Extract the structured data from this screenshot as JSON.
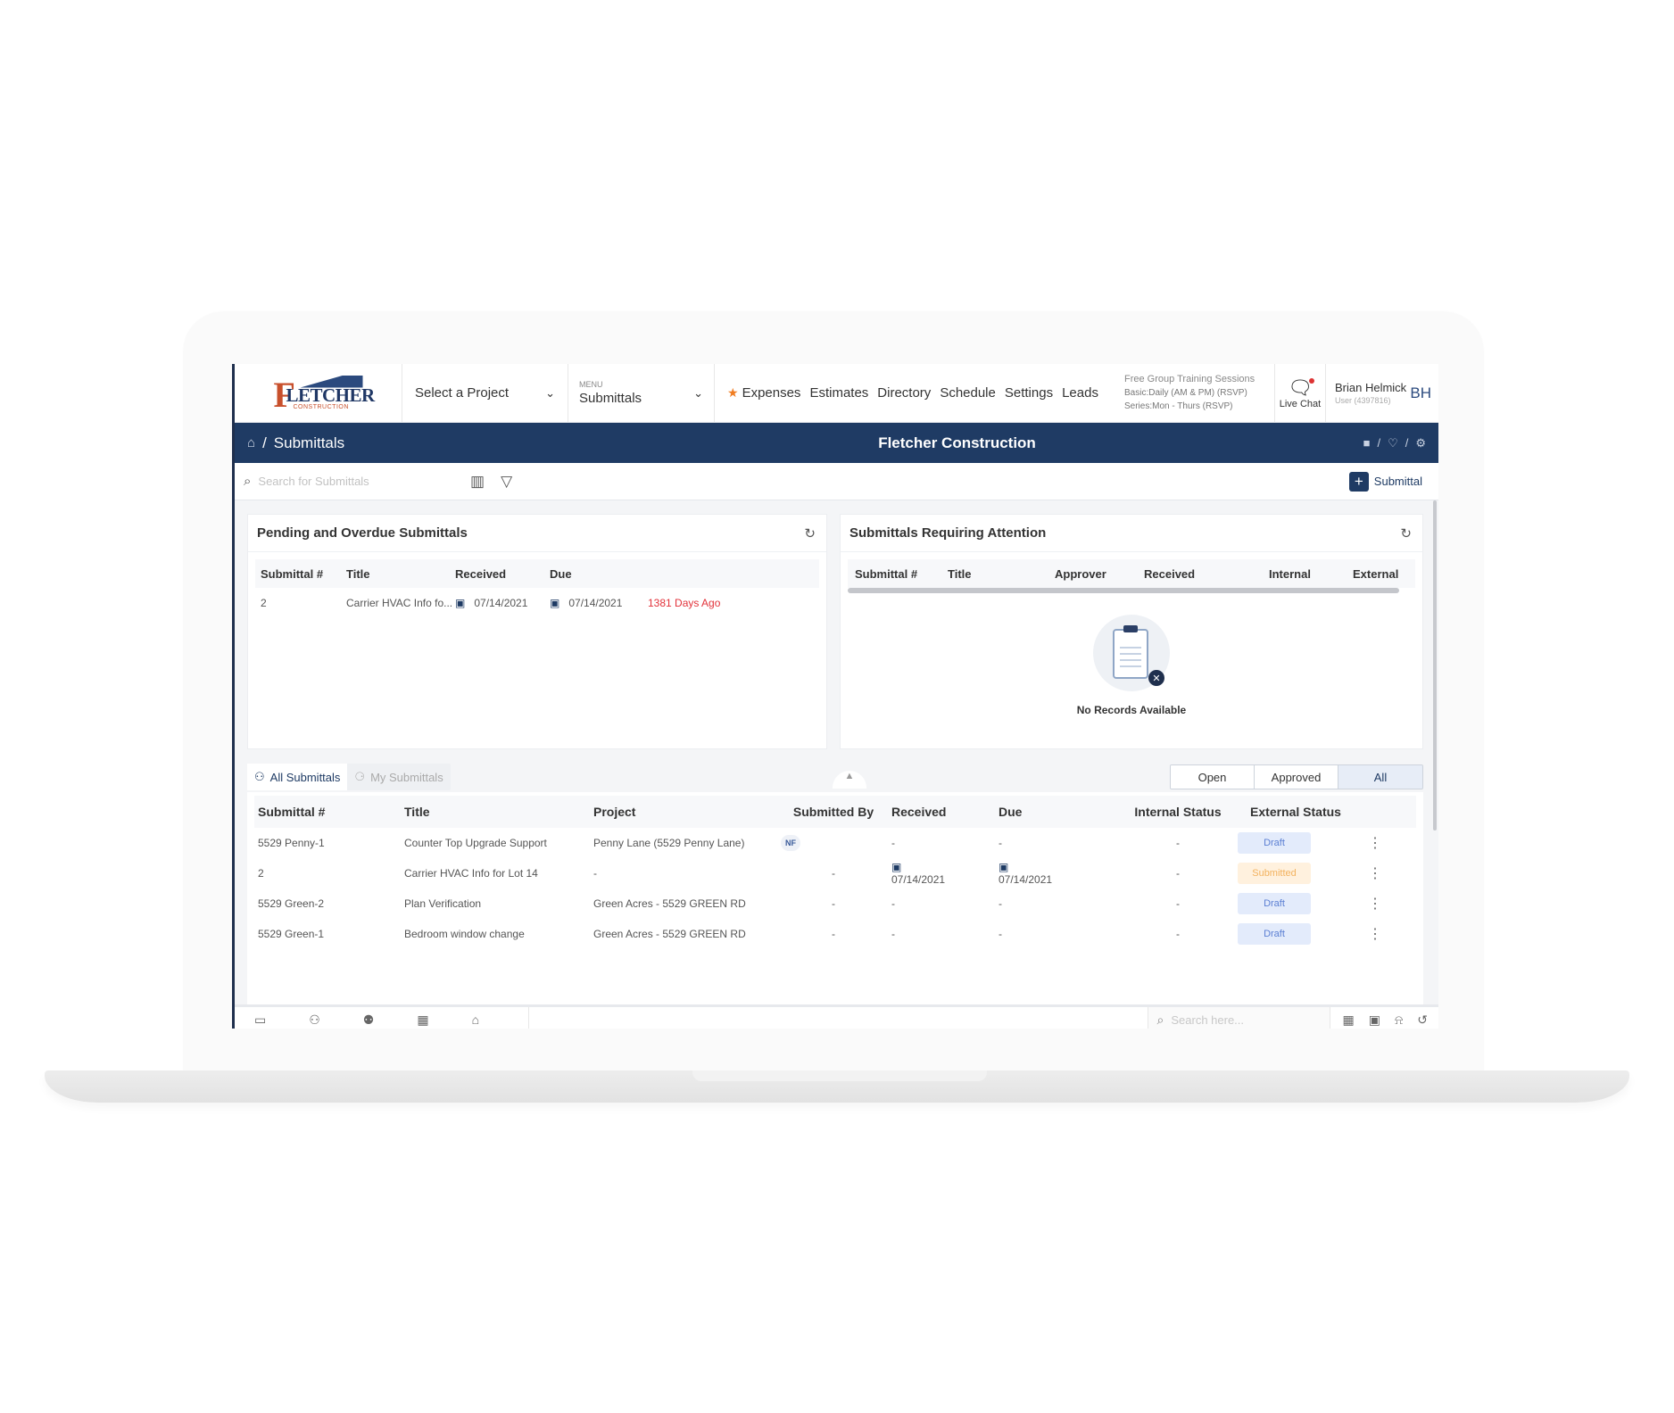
{
  "header": {
    "logo_text": "LETCHER",
    "logo_sub": "CONSTRUCTION",
    "project_select": "Select a Project",
    "menu_label": "MENU",
    "menu_value": "Submittals",
    "nav": [
      "Expenses",
      "Estimates",
      "Directory",
      "Schedule",
      "Settings",
      "Leads"
    ],
    "training": {
      "title": "Free Group Training Sessions",
      "basic": "Basic:Daily (AM & PM) (RSVP)",
      "series": "Series:Mon - Thurs (RSVP)"
    },
    "live_chat": "Live Chat",
    "user_name": "Brian Helmick",
    "user_sub": "User (4397816)",
    "avatar": "BH"
  },
  "titlebar": {
    "sep": "/",
    "breadcrumb": "Submittals",
    "company": "Fletcher Construction"
  },
  "toolbar": {
    "search_placeholder": "Search for Submittals",
    "add_label": "Submittal"
  },
  "pending": {
    "title": "Pending and Overdue Submittals",
    "columns": [
      "Submittal #",
      "Title",
      "Received",
      "Due"
    ],
    "rows": [
      {
        "num": "2",
        "title": "Carrier HVAC Info fo...",
        "received": "07/14/2021",
        "due": "07/14/2021",
        "overdue": "1381 Days Ago"
      }
    ]
  },
  "attention": {
    "title": "Submittals Requiring Attention",
    "columns": [
      "Submittal #",
      "Title",
      "Approver",
      "Received",
      "Internal",
      "External"
    ],
    "empty_text": "No Records Available"
  },
  "tabs": {
    "all": "All Submittals",
    "mine": "My Submittals",
    "filters": [
      "Open",
      "Approved",
      "All"
    ]
  },
  "main": {
    "columns": [
      "Submittal #",
      "Title",
      "Project",
      "Submitted By",
      "Received",
      "Due",
      "Internal Status",
      "External Status"
    ],
    "rows": [
      {
        "num": "5529 Penny-1",
        "title": "Counter Top Upgrade Support",
        "project": "Penny Lane (5529 Penny Lane)",
        "by": "NF",
        "received": "-",
        "due": "-",
        "internal": "-",
        "external": "Draft"
      },
      {
        "num": "2",
        "title": "Carrier HVAC Info for Lot 14",
        "project": "-",
        "by": "-",
        "received": "07/14/2021",
        "due": "07/14/2021",
        "internal": "-",
        "external": "Submitted"
      },
      {
        "num": "5529 Green-2",
        "title": "Plan Verification",
        "project": "Green Acres - 5529 GREEN RD",
        "by": "-",
        "received": "-",
        "due": "-",
        "internal": "-",
        "external": "Draft"
      },
      {
        "num": "5529 Green-1",
        "title": "Bedroom window change",
        "project": "Green Acres - 5529 GREEN RD",
        "by": "-",
        "received": "-",
        "due": "-",
        "internal": "-",
        "external": "Draft"
      }
    ]
  },
  "bottombar": {
    "search_placeholder": "Search here..."
  },
  "colors": {
    "navy": "#1f3b64",
    "accent_orange": "#f07d22",
    "overdue_red": "#e2323a",
    "draft_bg": "#e3ebfb",
    "submitted_bg": "#fff1de"
  }
}
